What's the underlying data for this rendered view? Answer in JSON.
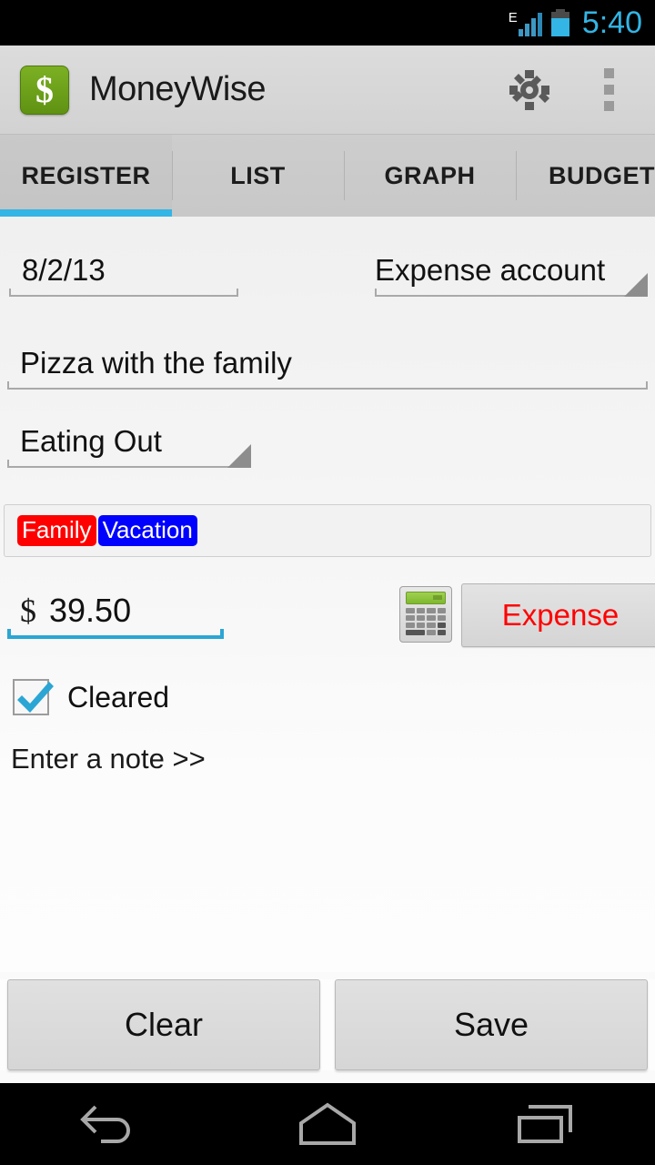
{
  "statusbar": {
    "network_type": "E",
    "time": "5:40",
    "signal_icon": "signal-bars-icon",
    "battery_icon": "battery-icon",
    "time_color": "#33b5e5"
  },
  "actionbar": {
    "app_title": "MoneyWise",
    "logo_symbol": "$",
    "logo_color": "#6ba315",
    "settings_icon": "gear-icon",
    "overflow_icon": "overflow-menu-icon"
  },
  "tabs": {
    "items": [
      {
        "label": "REGISTER",
        "active": true
      },
      {
        "label": "LIST",
        "active": false
      },
      {
        "label": "GRAPH",
        "active": false
      },
      {
        "label": "BUDGET",
        "active": false
      }
    ],
    "indicator_color": "#33b5e5"
  },
  "form": {
    "date": {
      "value": "8/2/13"
    },
    "account": {
      "value": "Expense account"
    },
    "description": {
      "value": "Pizza with the family"
    },
    "category": {
      "value": "Eating Out"
    },
    "tags": [
      {
        "label": "Family",
        "color": "#ff0000"
      },
      {
        "label": "Vacation",
        "color": "#0000ff"
      }
    ],
    "amount": {
      "currency": "$",
      "value": "39.50",
      "focus_color": "#2ba6d4"
    },
    "calculator": {
      "icon": "calculator-icon"
    },
    "type_button": {
      "label": "Expense",
      "color": "#ff0000"
    },
    "cleared": {
      "label": "Cleared",
      "checked": true
    },
    "note_link": {
      "label": "Enter a note >>"
    }
  },
  "footer": {
    "clear_button": "Clear",
    "save_button": "Save"
  },
  "navbar": {
    "back": "back-icon",
    "home": "home-icon",
    "recents": "recents-icon"
  }
}
